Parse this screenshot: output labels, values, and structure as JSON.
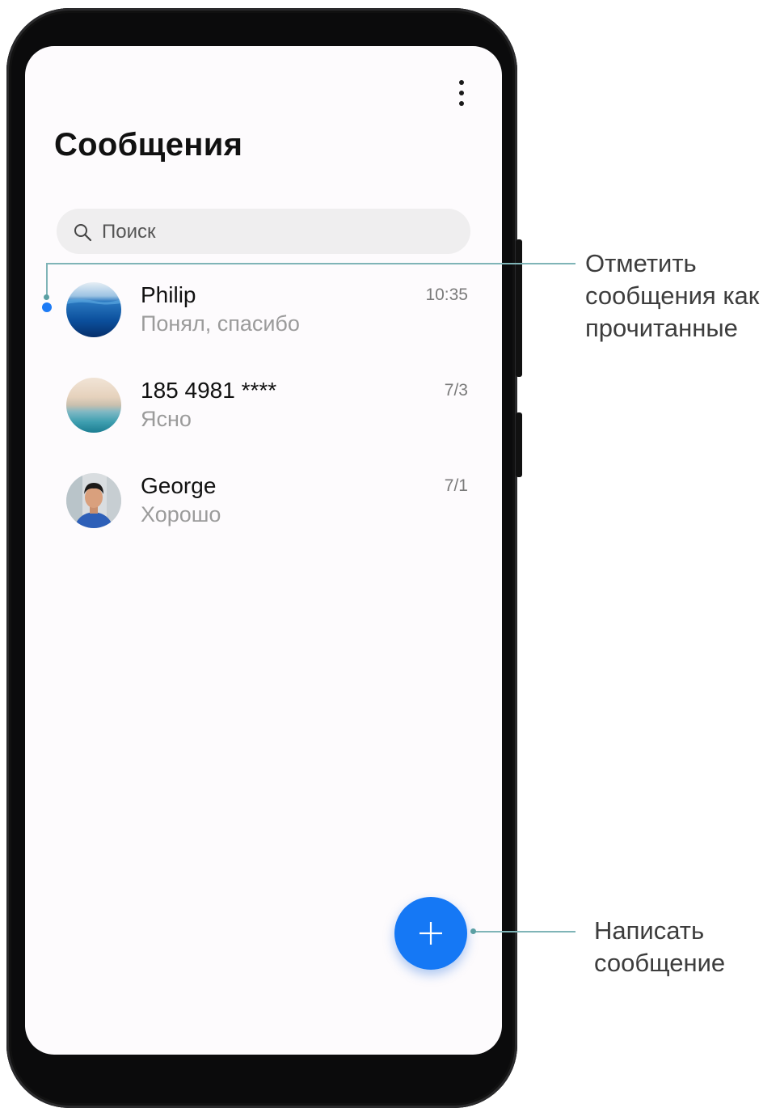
{
  "app": {
    "title": "Сообщения",
    "menu_icon": "more-vertical-icon"
  },
  "search": {
    "placeholder": "Поиск",
    "icon": "search-icon"
  },
  "conversations": [
    {
      "name": "Philip",
      "preview": "Понял, спасибо",
      "time": "10:35",
      "unread": true
    },
    {
      "name": "185 4981 ****",
      "preview": "Ясно",
      "time": "7/3",
      "unread": false
    },
    {
      "name": "George",
      "preview": "Хорошо",
      "time": "7/1",
      "unread": false
    }
  ],
  "fab": {
    "icon": "plus-icon"
  },
  "callouts": {
    "mark_read": [
      "Отметить",
      "сообщения как",
      "прочитанные"
    ],
    "new_message": [
      "Написать",
      "сообщение"
    ]
  },
  "colors": {
    "accent": "#1578f5",
    "unread_dot": "#1d7bf5",
    "callout_line": "#7fb4b7"
  }
}
